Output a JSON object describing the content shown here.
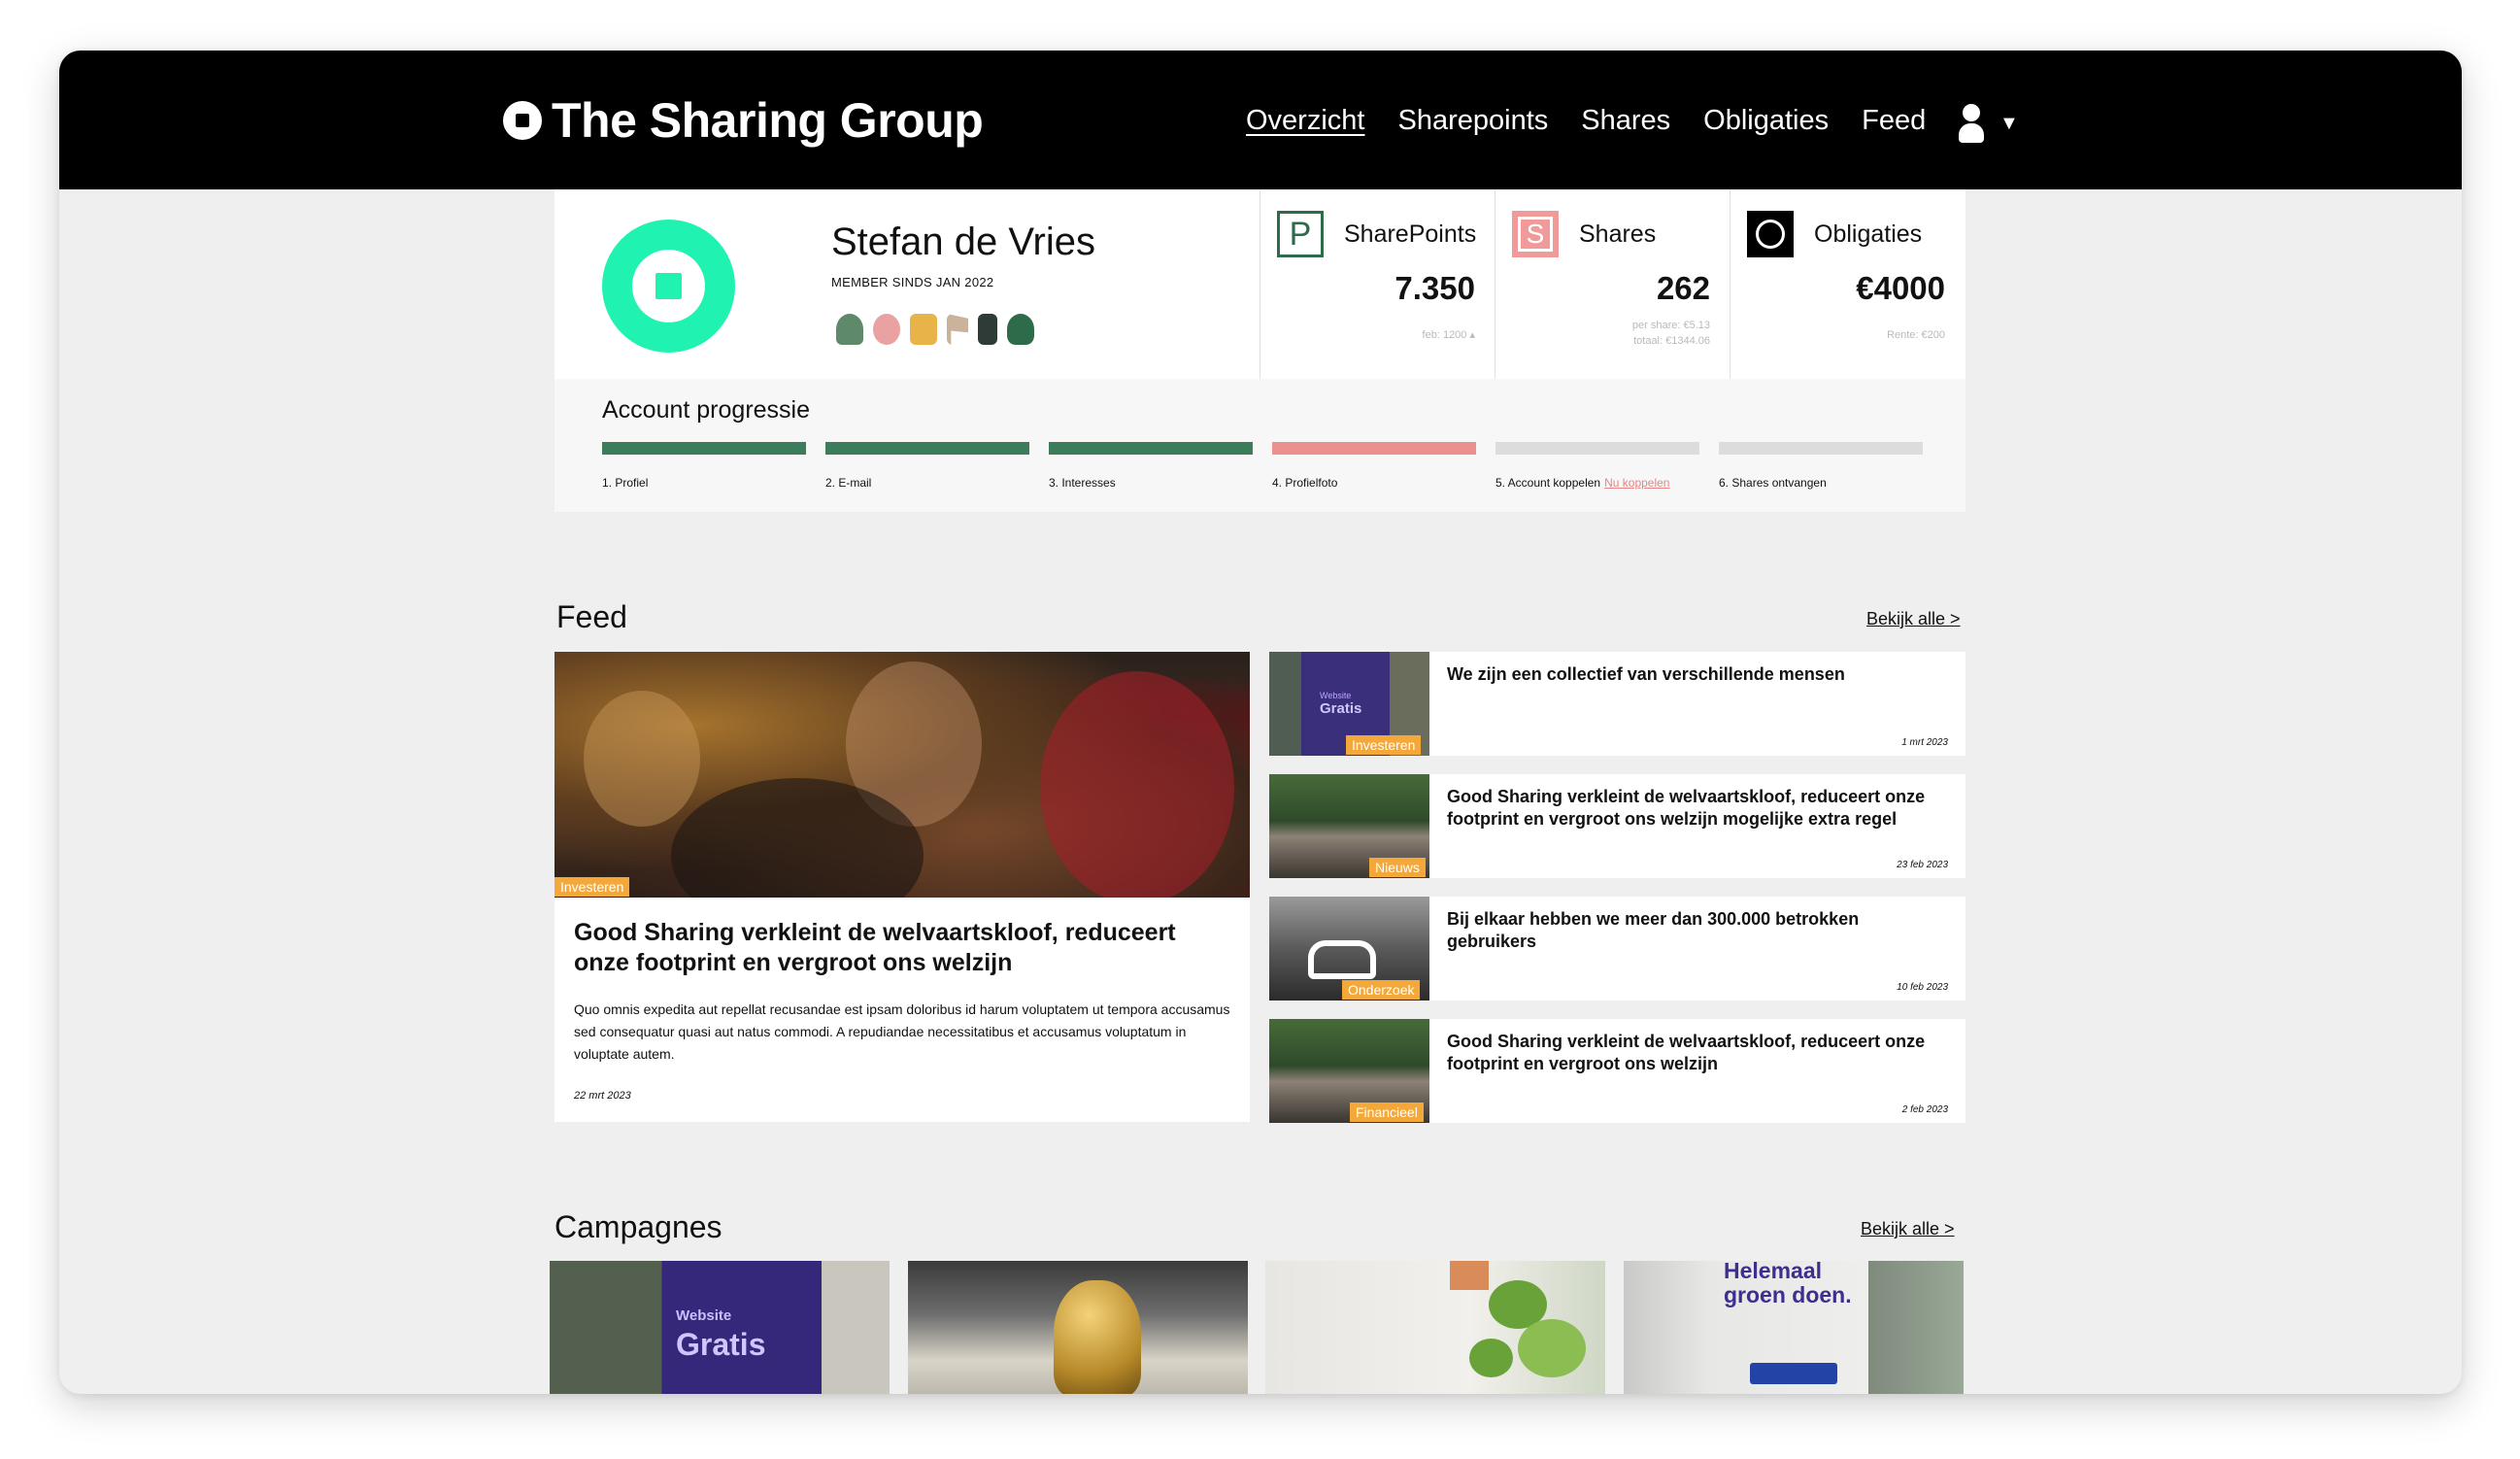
{
  "brand": {
    "name": "The Sharing Group"
  },
  "nav": {
    "links": [
      "Overzicht",
      "Sharepoints",
      "Shares",
      "Obligaties",
      "Feed"
    ],
    "active": "Overzicht",
    "caret": "▼"
  },
  "profile": {
    "name": "Stefan de Vries",
    "member_since": "MEMBER SINDS JAN 2022",
    "avatar_color": "#1ff2b1"
  },
  "stats": [
    {
      "icon": "P",
      "label": "SharePoints",
      "value": "7.350",
      "sub": "feb: 1200 ▴",
      "color": "#2e6b4a"
    },
    {
      "icon": "S",
      "label": "Shares",
      "value": "262",
      "sub": "per share: €5.13",
      "sub2": "totaal: €1344.06",
      "color": "#f09a9a"
    },
    {
      "icon": "O",
      "label": "Obligaties",
      "value": "€4000",
      "sub": "Rente: €200",
      "color": "#000000"
    }
  ],
  "progress": {
    "title": "Account progressie",
    "steps": [
      {
        "label": "1. Profiel",
        "status": "done"
      },
      {
        "label": "2. E-mail",
        "status": "done"
      },
      {
        "label": "3. Interesses",
        "status": "done"
      },
      {
        "label": "4. Profielfoto",
        "status": "pending"
      },
      {
        "label": "5. Account koppelen",
        "link": "Nu koppelen",
        "status": "todo"
      },
      {
        "label": "6. Shares ontvangen",
        "status": "todo"
      }
    ],
    "colors": {
      "done": "#3b7d5a",
      "pending": "#ec8f8f",
      "todo": "#dcdcdc"
    }
  },
  "feed": {
    "title": "Feed",
    "view_all": "Bekijk alle >",
    "main": {
      "tag": "Investeren",
      "title": "Good Sharing verkleint de welvaartskloof, reduceert onze footprint en vergroot ons welzijn",
      "text": "Quo omnis expedita aut repellat recusandae est ipsam doloribus id harum voluptatem ut tempora accusamus sed consequatur quasi aut natus commodi. A repudiandae necessitatibus et accusamus voluptatum in voluptate autem.",
      "date": "22 mrt 2023"
    },
    "items": [
      {
        "tag": "Investeren",
        "title": "We zijn een collectief van verschillende mensen",
        "date": "1 mrt 2023",
        "thumb_word1": "Website",
        "thumb_word2": "Gratis"
      },
      {
        "tag": "Nieuws",
        "title": "Good Sharing verkleint de welvaartskloof, reduceert onze footprint en vergroot ons welzijn mogelijke extra regel",
        "date": "23 feb 2023"
      },
      {
        "tag": "Onderzoek",
        "title": "Bij elkaar hebben we meer dan 300.000 betrokken gebruikers",
        "date": "10 feb 2023"
      },
      {
        "tag": "Financieel",
        "title": "Good Sharing verkleint de welvaartskloof, reduceert onze footprint en vergroot ons welzijn",
        "date": "2 feb 2023"
      }
    ],
    "tag_color": "#f5a83a"
  },
  "campaigns": {
    "title": "Campagnes",
    "view_all": "Bekijk alle >",
    "c1_word1": "Website",
    "c1_word2": "Gratis",
    "c4_heading1": "Helemaal",
    "c4_heading2": "groen doen."
  }
}
